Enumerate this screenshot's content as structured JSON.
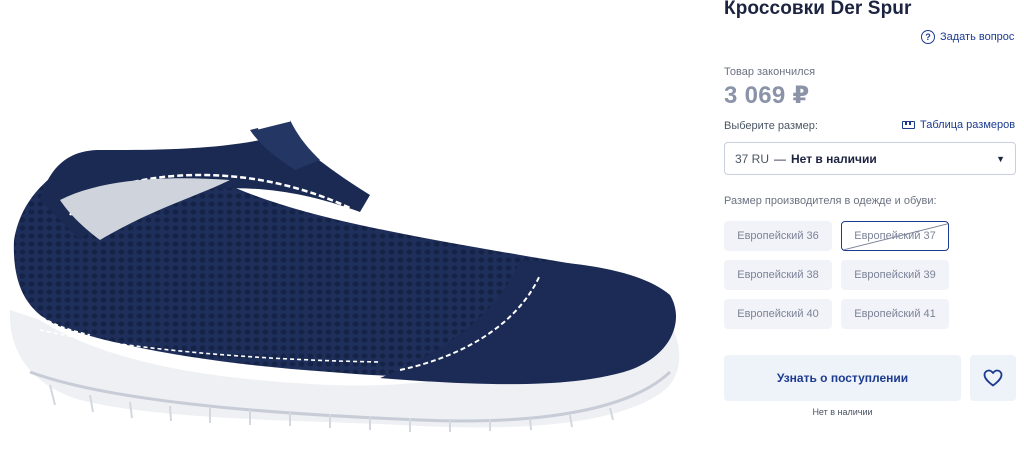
{
  "product": {
    "title": "Кроссовки Der Spur",
    "ask_question": "Задать вопрос",
    "status": "Товар закончился",
    "price": "3 069 ₽"
  },
  "size": {
    "label": "Выберите размер:",
    "table_link": "Таблица размеров",
    "selected_size": "37 RU",
    "separator": "—",
    "selected_availability": "Нет в наличии"
  },
  "manufacturer": {
    "label": "Размер производителя в одежде и обуви:",
    "sizes": [
      "Европейский 36",
      "Европейский 37",
      "Европейский 38",
      "Европейский 39",
      "Европейский 40",
      "Европейский 41"
    ]
  },
  "actions": {
    "notify_label": "Узнать о поступлении",
    "not_available_note": "Нет в наличии"
  },
  "image": {
    "subject": "navy-mesh-slip-on-sneaker"
  },
  "colors": {
    "accent": "#1c3b8f",
    "title": "#1c2340",
    "price_muted": "#8b93a8",
    "chip_bg": "#f1f3f8",
    "button_bg": "#eef2f9",
    "shoe_navy": "#1f2f5c"
  },
  "icons": {
    "ask": "question-circle-icon",
    "size_table": "ruler-icon",
    "select": "caret-down-icon",
    "favorite": "heart-icon"
  }
}
